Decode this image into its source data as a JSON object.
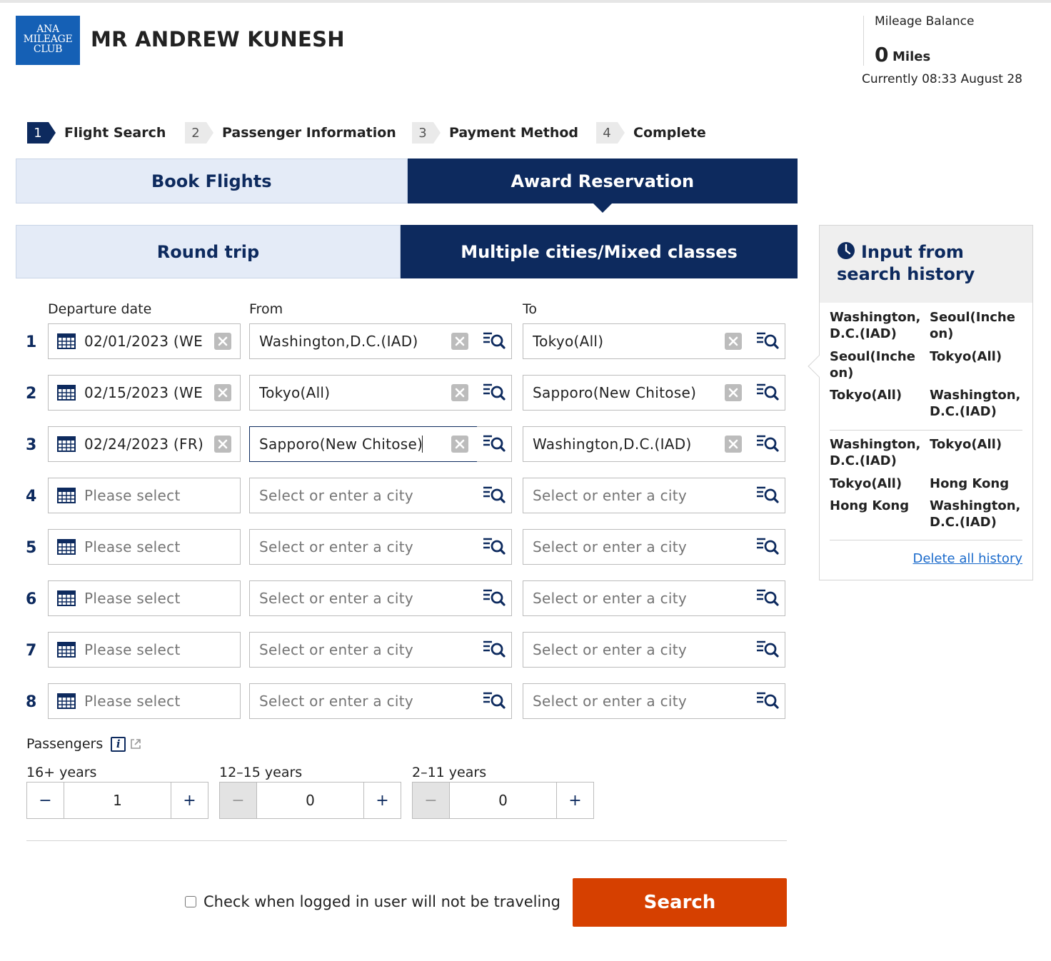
{
  "header": {
    "logo_lines": [
      "ANA",
      "MILEAGE",
      "CLUB"
    ],
    "member_name": "MR ANDREW KUNESH",
    "mileage_label": "Mileage Balance",
    "mileage_value": "0",
    "mileage_unit": "Miles",
    "current_time": "Currently 08:33 August 28"
  },
  "steps": [
    {
      "num": "1",
      "label": "Flight Search",
      "active": true
    },
    {
      "num": "2",
      "label": "Passenger Information",
      "active": false
    },
    {
      "num": "3",
      "label": "Payment Method",
      "active": false
    },
    {
      "num": "4",
      "label": "Complete",
      "active": false
    }
  ],
  "booking_tabs": {
    "book": "Book Flights",
    "award": "Award Reservation",
    "selected": "award"
  },
  "trip_tabs": {
    "round": "Round trip",
    "multi": "Multiple cities/Mixed classes",
    "selected": "multi"
  },
  "columns": {
    "date": "Departure date",
    "from": "From",
    "to": "To"
  },
  "placeholders": {
    "date": "Please select",
    "city": "Select or enter a city"
  },
  "segments": [
    {
      "num": "1",
      "date": "02/01/2023 (WE",
      "from": "Washington,D.C.(IAD)",
      "to": "Tokyo(All)"
    },
    {
      "num": "2",
      "date": "02/15/2023 (WE",
      "from": "Tokyo(All)",
      "to": "Sapporo(New Chitose)"
    },
    {
      "num": "3",
      "date": "02/24/2023 (FR)",
      "from": "Sapporo(New Chitose)",
      "to": "Washington,D.C.(IAD)"
    },
    {
      "num": "4",
      "date": "",
      "from": "",
      "to": ""
    },
    {
      "num": "5",
      "date": "",
      "from": "",
      "to": ""
    },
    {
      "num": "6",
      "date": "",
      "from": "",
      "to": ""
    },
    {
      "num": "7",
      "date": "",
      "from": "",
      "to": ""
    },
    {
      "num": "8",
      "date": "",
      "from": "",
      "to": ""
    }
  ],
  "history": {
    "title_line1": "Input from",
    "title_line2": "search history",
    "groups": [
      [
        {
          "from": "Washington, D.C.(IAD)",
          "to": "Seoul(Incheon)"
        },
        {
          "from": "Seoul(Incheon)",
          "to": "Tokyo(All)"
        },
        {
          "from": "Tokyo(All)",
          "to": "Washington, D.C.(IAD)"
        }
      ],
      [
        {
          "from": "Washington, D.C.(IAD)",
          "to": "Tokyo(All)"
        },
        {
          "from": "Tokyo(All)",
          "to": "Hong Kong"
        },
        {
          "from": "Hong Kong",
          "to": "Washington, D.C.(IAD)"
        }
      ]
    ],
    "delete_label": "Delete all history"
  },
  "passengers": {
    "label": "Passengers",
    "info_glyph": "i",
    "groups": [
      {
        "label": "16+ years",
        "value": "1",
        "minus": "−",
        "plus": "+",
        "minus_disabled": false
      },
      {
        "label": "12–15 years",
        "value": "0",
        "minus": "−",
        "plus": "+",
        "minus_disabled": true
      },
      {
        "label": "2–11 years",
        "value": "0",
        "minus": "−",
        "plus": "+",
        "minus_disabled": true
      }
    ]
  },
  "footer": {
    "not_traveling_label": "Check when logged in user will not be traveling",
    "search_label": "Search"
  },
  "colors": {
    "brand_navy": "#0d2a5e",
    "search_orange": "#d64000",
    "link_blue": "#1a6acb",
    "logo_blue": "#1560b5"
  }
}
